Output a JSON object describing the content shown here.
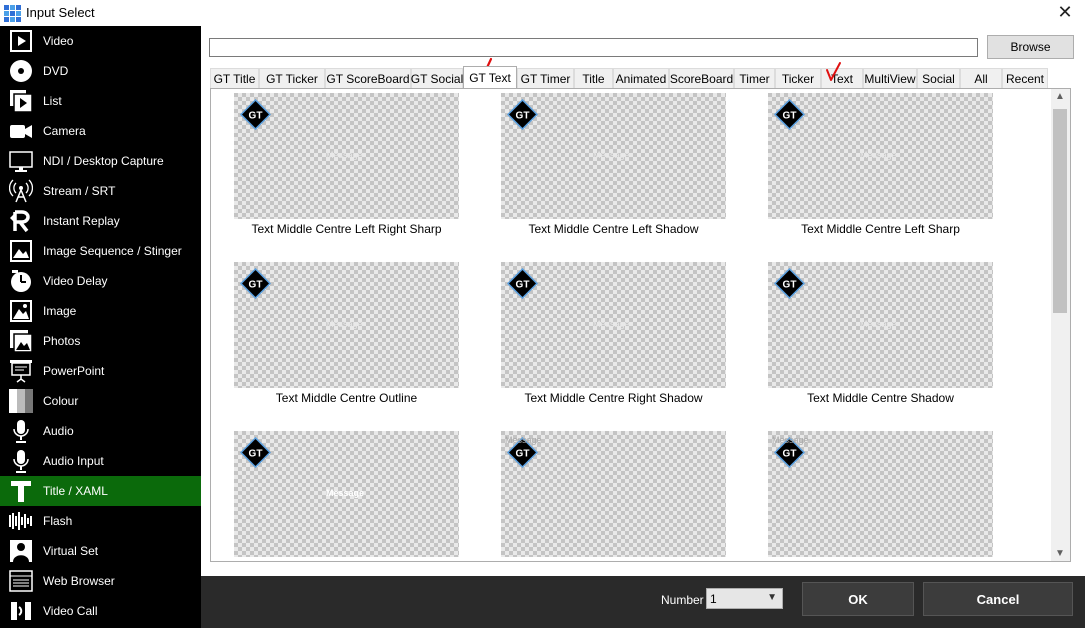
{
  "window": {
    "title": "Input Select",
    "close_glyph": "✕"
  },
  "sidebar": {
    "items": [
      {
        "label": "Video",
        "icon": "video-icon"
      },
      {
        "label": "DVD",
        "icon": "dvd-icon"
      },
      {
        "label": "List",
        "icon": "list-icon"
      },
      {
        "label": "Camera",
        "icon": "camera-icon"
      },
      {
        "label": "NDI / Desktop Capture",
        "icon": "monitor-icon"
      },
      {
        "label": "Stream / SRT",
        "icon": "stream-icon"
      },
      {
        "label": "Instant Replay",
        "icon": "replay-icon"
      },
      {
        "label": "Image Sequence / Stinger",
        "icon": "image-sequence-icon"
      },
      {
        "label": "Video Delay",
        "icon": "clock-icon"
      },
      {
        "label": "Image",
        "icon": "image-icon"
      },
      {
        "label": "Photos",
        "icon": "photos-icon"
      },
      {
        "label": "PowerPoint",
        "icon": "powerpoint-icon"
      },
      {
        "label": "Colour",
        "icon": "colour-icon"
      },
      {
        "label": "Audio",
        "icon": "microphone-icon"
      },
      {
        "label": "Audio Input",
        "icon": "audio-input-icon"
      },
      {
        "label": "Title / XAML",
        "icon": "title-icon",
        "active": true
      },
      {
        "label": "Flash",
        "icon": "flash-icon"
      },
      {
        "label": "Virtual Set",
        "icon": "virtual-set-icon"
      },
      {
        "label": "Web Browser",
        "icon": "web-browser-icon"
      },
      {
        "label": "Video Call",
        "icon": "video-call-icon"
      }
    ],
    "active_color": "#0b6a0b"
  },
  "path_field": {
    "value": ""
  },
  "browse_label": "Browse",
  "tabs": [
    "GT Title",
    "GT Ticker",
    "GT ScoreBoard",
    "GT Social",
    "GT Text",
    "GT Timer",
    "Title",
    "Animated",
    "ScoreBoard",
    "Timer",
    "Ticker",
    "Text",
    "MultiView",
    "Social",
    "All",
    "Recent"
  ],
  "selected_tab": "GT Text",
  "badge_text": "GT",
  "message_placeholder": "Message",
  "cards": [
    {
      "label": "Text Middle Centre Left Right Sharp"
    },
    {
      "label": "Text Middle Centre Left Shadow"
    },
    {
      "label": "Text Middle Centre Left Sharp"
    },
    {
      "label": "Text Middle Centre Outline"
    },
    {
      "label": "Text Middle Centre Right Shadow"
    },
    {
      "label": "Text Middle Centre Shadow"
    },
    {
      "label": ""
    },
    {
      "label": ""
    },
    {
      "label": ""
    }
  ],
  "footer": {
    "number_label": "Number",
    "number_value": "1",
    "ok_label": "OK",
    "cancel_label": "Cancel"
  },
  "accent_colors": {
    "annotation": "#e01010",
    "badge_ring": "#5aa0e0"
  }
}
